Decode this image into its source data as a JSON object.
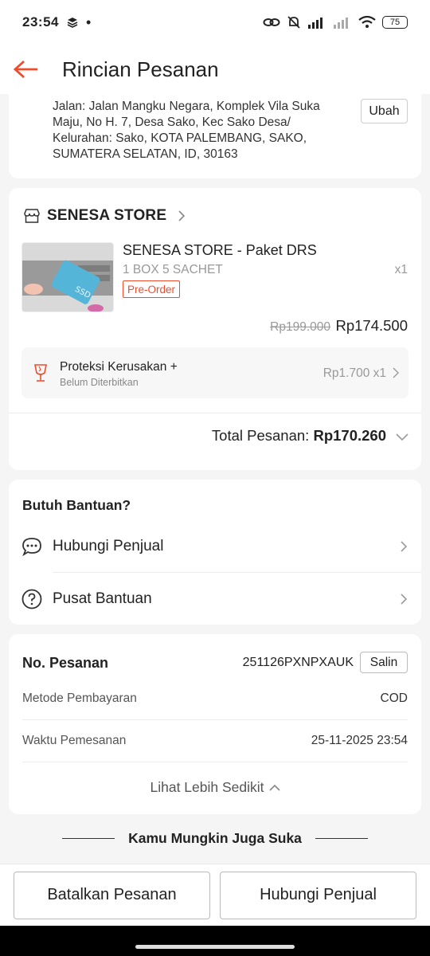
{
  "status_bar": {
    "time": "23:54",
    "battery": "75"
  },
  "header": {
    "title": "Rincian Pesanan"
  },
  "address": {
    "text": "Jalan: Jalan Mangku Negara, Komplek Vila Suka Maju, No H. 7, Desa Sako, Kec Sako Desa/ Kelurahan: Sako, KOTA PALEMBANG, SAKO, SUMATERA SELATAN, ID, 30163",
    "change_label": "Ubah"
  },
  "store": {
    "name": "SENESA STORE",
    "product": {
      "name": "SENESA STORE - Paket DRS",
      "variant": "1 BOX 5 SACHET",
      "qty": "x1",
      "tag": "Pre-Order",
      "image_label": "SSD",
      "price_original": "Rp199.000",
      "price": "Rp174.500"
    },
    "protection": {
      "title": "Proteksi Kerusakan +",
      "subtitle": "Belum Diterbitkan",
      "price": "Rp1.700 x1"
    },
    "total_label": "Total Pesanan:",
    "total_value": "Rp170.260"
  },
  "help": {
    "title": "Butuh Bantuan?",
    "items": [
      {
        "label": "Hubungi Penjual"
      },
      {
        "label": "Pusat Bantuan"
      }
    ]
  },
  "order": {
    "no_label": "No. Pesanan",
    "no_value": "251126PXNPXAUK",
    "copy_label": "Salin",
    "payment_label": "Metode Pembayaran",
    "payment_value": "COD",
    "time_label": "Waktu Pemesanan",
    "time_value": "25-11-2025 23:54",
    "see_less": "Lihat Lebih Sedikit"
  },
  "suggestions": {
    "title": "Kamu Mungkin Juga Suka"
  },
  "actions": {
    "cancel": "Batalkan Pesanan",
    "contact": "Hubungi Penjual"
  },
  "colors": {
    "accent": "#ee4d2d"
  }
}
